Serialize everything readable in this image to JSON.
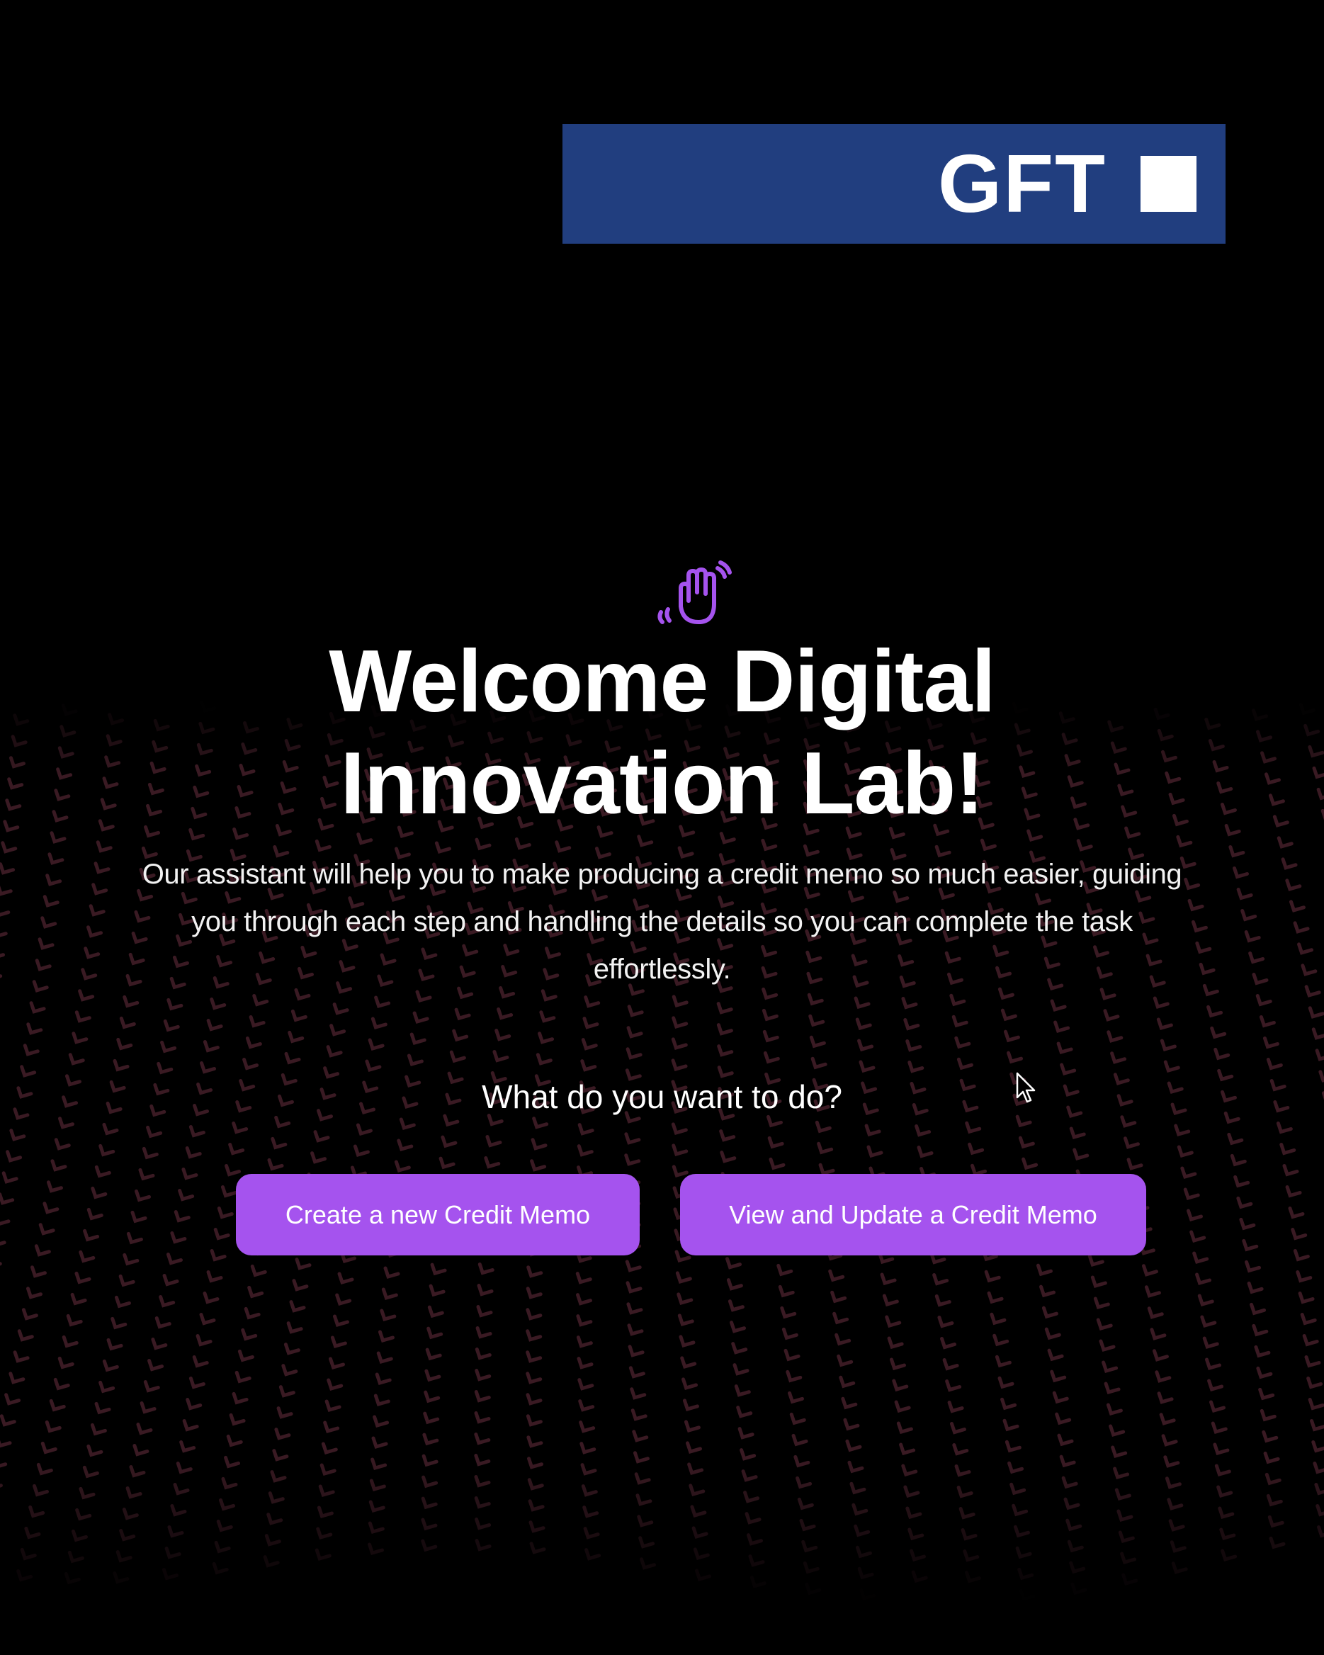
{
  "brand": {
    "logo_text": "GFT",
    "logo_color": "#213e7f"
  },
  "hero": {
    "icon": "waving-hand-icon",
    "icon_color": "#a553ee",
    "title_line1": "Welcome Digital",
    "title_line2": "Innovation Lab!",
    "description": "Our assistant will help you to make producing a credit memo so much easier, guiding you through each step and handling the details so you can complete the task effortlessly.",
    "question": "What do you want to do?"
  },
  "actions": {
    "create_label": "Create a new Credit Memo",
    "view_label": "View and Update a Credit Memo",
    "button_color": "#a553ee"
  },
  "cursor": {
    "icon": "mouse-pointer-icon"
  }
}
